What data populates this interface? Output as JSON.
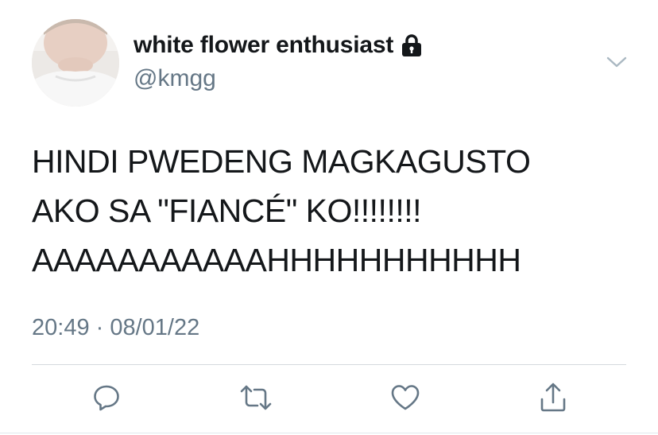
{
  "tweet": {
    "display_name": "white flower enthusiast",
    "handle": "@kmgg",
    "protected": true,
    "text": "HINDI PWEDENG MAGKAGUSTO\nAKO SA \"FIANCÉ\" KO!!!!!!!!\nAAAAAAAAAAAHHHHHHHHHHH",
    "timestamp": "20:49 · 08/01/22"
  },
  "actions": {
    "reply_icon": "reply-icon",
    "retweet_icon": "retweet-icon",
    "like_icon": "heart-icon",
    "share_icon": "share-icon"
  },
  "colors": {
    "primary_text": "#14171a",
    "secondary_text": "#657786",
    "divider": "#d4d9dd"
  }
}
